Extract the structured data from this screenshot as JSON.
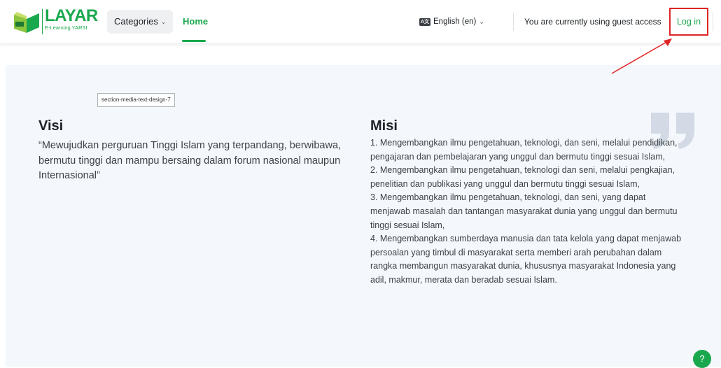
{
  "logo": {
    "title": "LAYAR",
    "subtitle": "E-Learning YARSI",
    "mark_text": "YARSI"
  },
  "nav": {
    "categories_label": "Categories",
    "home_label": "Home",
    "language_label": "English (en)",
    "language_icon": "A文",
    "guest_text": "You are currently using guest access",
    "login_label": "Log in"
  },
  "section": {
    "tag_label": "section-media-text-design-7",
    "visi_title": "Visi",
    "visi_text": "“Mewujudkan perguruan Tinggi Islam yang terpandang, berwibawa, bermutu tinggi dan mampu bersaing dalam forum nasional maupun Internasional”",
    "misi_title": "Misi",
    "misi_items": [
      "1. Mengembangkan ilmu pengetahuan, teknologi, dan seni, melalui pendidikan, pengajaran dan pembelajaran yang unggul dan bermutu tinggi sesuai Islam,",
      "2. Mengembangkan ilmu pengetahuan, teknologi dan seni, melalui pengkajian, penelitian dan publikasi yang unggul dan bermutu tinggi sesuai Islam,",
      "3. Mengembangkan ilmu pengetahuan, teknologi, dan seni, yang dapat menjawab masalah dan tantangan masyarakat dunia yang unggul dan bermutu tinggi sesuai Islam,",
      "4. Mengembangkan sumberdaya manusia dan tata kelola yang dapat menjawab persoalan yang timbul di masyarakat serta memberi arah perubahan dalam rangka membangun masyarakat dunia, khususnya masyarakat Indonesia yang adil, makmur, merata dan beradab sesuai Islam."
    ]
  },
  "help": {
    "icon": "?"
  },
  "colors": {
    "brand_green": "#1aa84e",
    "highlight_red": "#e02424",
    "section_bg": "#f4f7fb"
  },
  "icons": [
    "logo-book-icon",
    "chevron-down-icon",
    "language-icon",
    "quote-icon",
    "annotation-arrow-icon",
    "help-icon"
  ]
}
